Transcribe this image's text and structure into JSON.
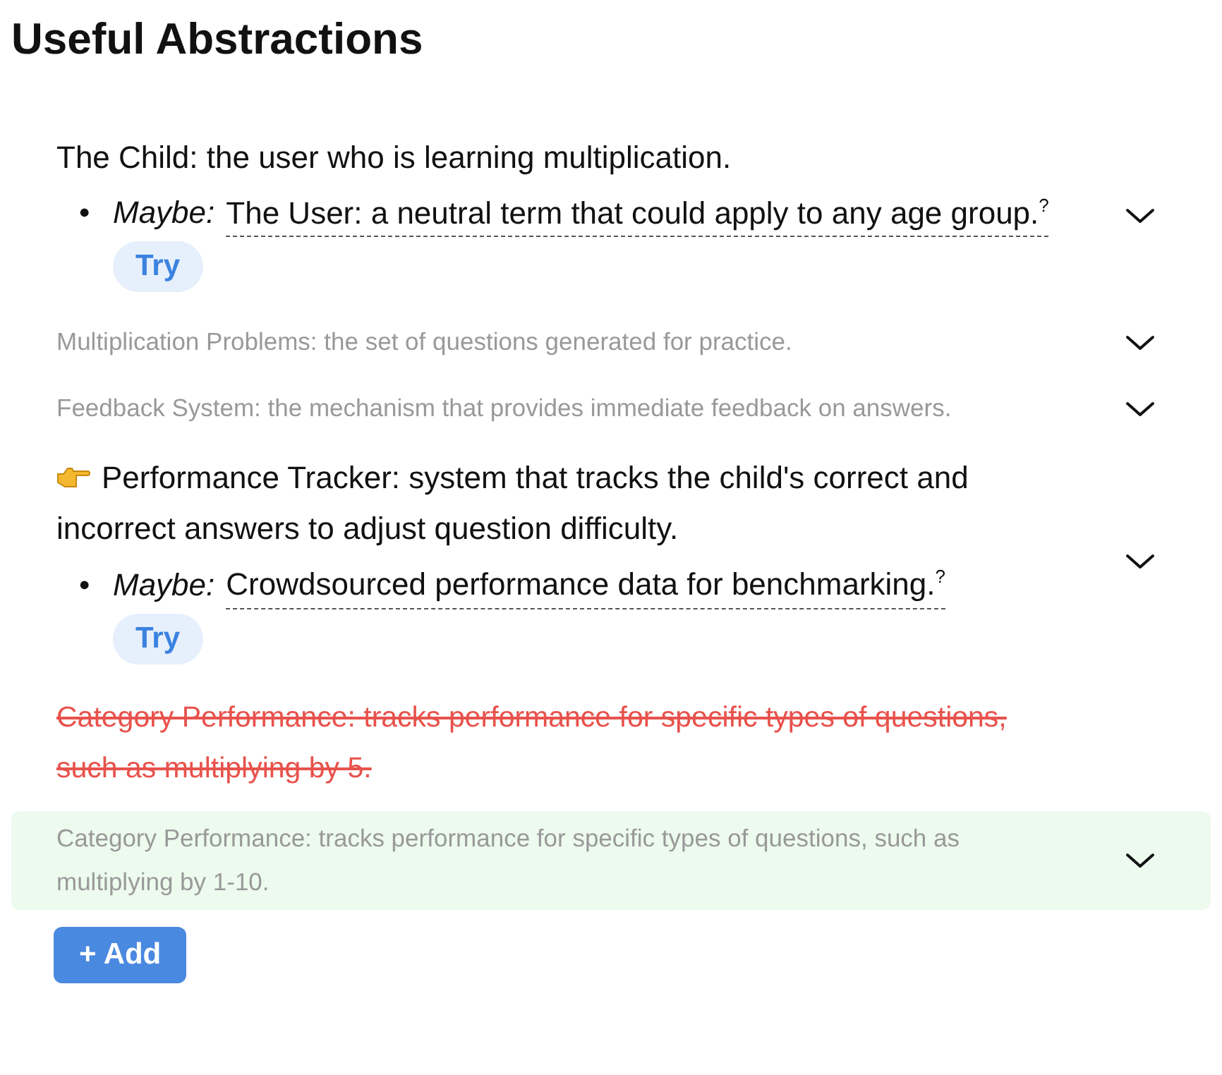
{
  "title": "Useful Abstractions",
  "items": [
    {
      "kind": "active",
      "current": false,
      "text": "The Child: the user who is learning multiplication.",
      "suggestion": {
        "bullet": "•",
        "label": "Maybe:",
        "text": "The User: a neutral term that could apply to any age group.",
        "mark": "?",
        "button": "Try"
      }
    },
    {
      "kind": "dim",
      "current": false,
      "text": "Multiplication Problems: the set of questions generated for practice."
    },
    {
      "kind": "dim",
      "current": false,
      "text": "Feedback System: the mechanism that provides immediate feedback on answers."
    },
    {
      "kind": "active",
      "current": true,
      "text": "Performance Tracker: system that tracks the child's correct and incorrect answers to adjust question difficulty.",
      "suggestion": {
        "bullet": "•",
        "label": "Maybe:",
        "text": "Crowdsourced performance data for benchmarking.",
        "mark": "?",
        "button": "Try"
      }
    },
    {
      "kind": "removed",
      "current": false,
      "text": "Category Performance: tracks performance for specific types of questions, such as multiplying by 5."
    },
    {
      "kind": "added",
      "current": false,
      "text": "Category Performance: tracks performance for specific types of questions, such as multiplying by 1-10."
    }
  ],
  "add_button": "+ Add"
}
